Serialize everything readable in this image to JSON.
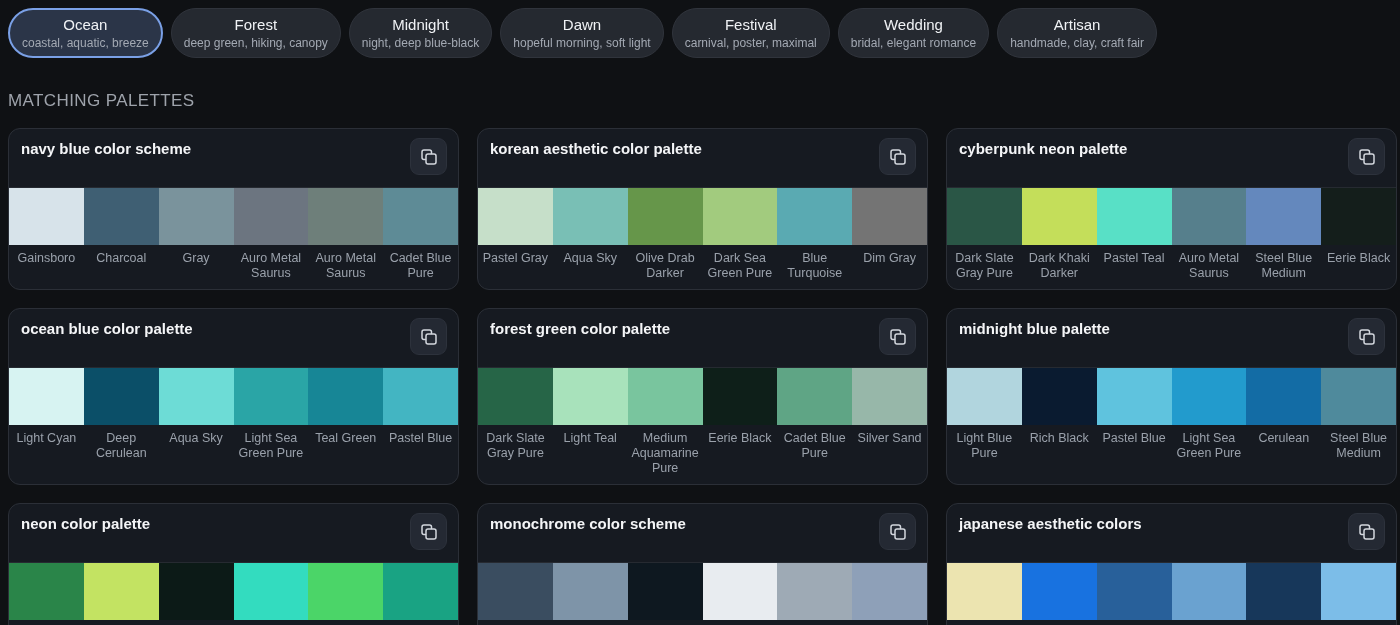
{
  "tabs": [
    {
      "label": "Ocean",
      "subtitle": "coastal, aquatic, breeze",
      "selected": true
    },
    {
      "label": "Forest",
      "subtitle": "deep green, hiking, canopy",
      "selected": false
    },
    {
      "label": "Midnight",
      "subtitle": "night, deep blue-black",
      "selected": false
    },
    {
      "label": "Dawn",
      "subtitle": "hopeful morning, soft light",
      "selected": false
    },
    {
      "label": "Festival",
      "subtitle": "carnival, poster, maximal",
      "selected": false
    },
    {
      "label": "Wedding",
      "subtitle": "bridal, elegant romance",
      "selected": false
    },
    {
      "label": "Artisan",
      "subtitle": "handmade, clay, craft fair",
      "selected": false
    }
  ],
  "section_title": "MATCHING PALETTES",
  "palettes": [
    {
      "title": "navy blue color scheme",
      "swatches": [
        {
          "name": "Gainsboro",
          "color": "#d7e3ea"
        },
        {
          "name": "Charcoal",
          "color": "#3f5f73"
        },
        {
          "name": "Gray",
          "color": "#7a939c"
        },
        {
          "name": "Auro Metal Saurus",
          "color": "#6c7580"
        },
        {
          "name": "Auro Metal Saurus",
          "color": "#6e7f7a"
        },
        {
          "name": "Cadet Blue Pure",
          "color": "#5e8b96"
        }
      ]
    },
    {
      "title": "korean aesthetic color palette",
      "swatches": [
        {
          "name": "Pastel Gray",
          "color": "#c6dfc9"
        },
        {
          "name": "Aqua Sky",
          "color": "#79bfb5"
        },
        {
          "name": "Olive Drab Darker",
          "color": "#66964a"
        },
        {
          "name": "Dark Sea Green Pure",
          "color": "#a2cb7e"
        },
        {
          "name": "Blue Turquoise",
          "color": "#5aaab2"
        },
        {
          "name": "Dim Gray",
          "color": "#747474"
        }
      ]
    },
    {
      "title": "cyberpunk neon palette",
      "swatches": [
        {
          "name": "Dark Slate Gray Pure",
          "color": "#2a5646"
        },
        {
          "name": "Dark Khaki Darker",
          "color": "#c4de5a"
        },
        {
          "name": "Pastel Teal",
          "color": "#58e0c6"
        },
        {
          "name": "Auro Metal Saurus",
          "color": "#567f8c"
        },
        {
          "name": "Steel Blue Medium",
          "color": "#6488bd"
        },
        {
          "name": "Eerie Black",
          "color": "#141e1b"
        }
      ]
    },
    {
      "title": "ocean blue color palette",
      "swatches": [
        {
          "name": "Light Cyan",
          "color": "#d7f3f2"
        },
        {
          "name": "Deep Cerulean",
          "color": "#0b4f68"
        },
        {
          "name": "Aqua Sky",
          "color": "#6ddcd6"
        },
        {
          "name": "Light Sea Green Pure",
          "color": "#2aa5a6"
        },
        {
          "name": "Teal Green",
          "color": "#178696"
        },
        {
          "name": "Pastel Blue",
          "color": "#43b5c2"
        }
      ]
    },
    {
      "title": "forest green color palette",
      "swatches": [
        {
          "name": "Dark Slate Gray Pure",
          "color": "#266547"
        },
        {
          "name": "Light Teal",
          "color": "#a8e2bb"
        },
        {
          "name": "Medium Aquamarine Pure",
          "color": "#79c59e"
        },
        {
          "name": "Eerie Black",
          "color": "#0e1f19"
        },
        {
          "name": "Cadet Blue Pure",
          "color": "#5fa585"
        },
        {
          "name": "Silver Sand",
          "color": "#97b7a9"
        }
      ]
    },
    {
      "title": "midnight blue palette",
      "swatches": [
        {
          "name": "Light Blue Pure",
          "color": "#b1d5de"
        },
        {
          "name": "Rich Black",
          "color": "#0a1b30"
        },
        {
          "name": "Pastel Blue",
          "color": "#5fc3de"
        },
        {
          "name": "Light Sea Green Pure",
          "color": "#229bcd"
        },
        {
          "name": "Cerulean",
          "color": "#136ca5"
        },
        {
          "name": "Steel Blue Medium",
          "color": "#4f8a9c"
        }
      ]
    },
    {
      "title": "neon color palette",
      "swatches": [
        {
          "color": "#2a8549"
        },
        {
          "color": "#c3e362"
        },
        {
          "color": "#0c1a17"
        },
        {
          "color": "#33dcbf"
        },
        {
          "color": "#4bd568"
        },
        {
          "color": "#19a383"
        }
      ]
    },
    {
      "title": "monochrome color scheme",
      "swatches": [
        {
          "color": "#3a4d60"
        },
        {
          "color": "#7e94a8"
        },
        {
          "color": "#0e1820"
        },
        {
          "color": "#e8ecf0"
        },
        {
          "color": "#9eaab5"
        },
        {
          "color": "#8ea0b8"
        }
      ]
    },
    {
      "title": "japanese aesthetic colors",
      "swatches": [
        {
          "color": "#ece4b0"
        },
        {
          "color": "#1872e0"
        },
        {
          "color": "#28609a"
        },
        {
          "color": "#6aa2d0"
        },
        {
          "color": "#17375a"
        },
        {
          "color": "#7cbde8"
        }
      ]
    }
  ]
}
